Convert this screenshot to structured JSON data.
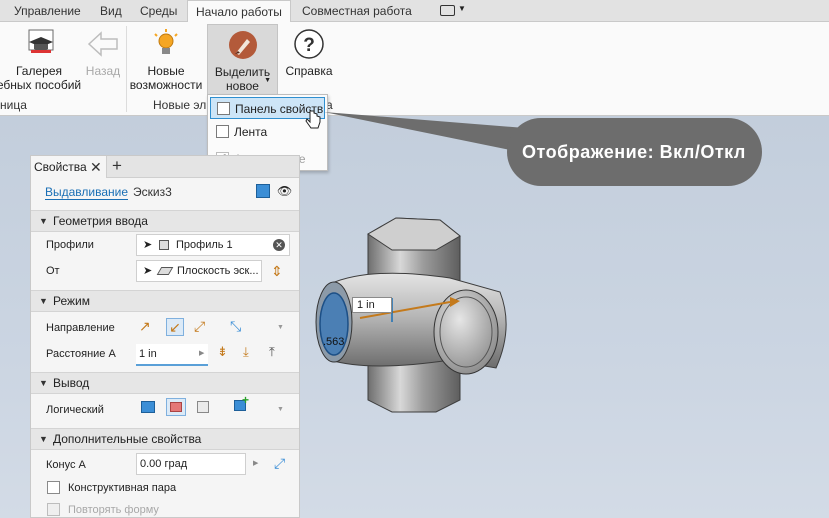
{
  "ribbon": {
    "tabs": [
      "Управление",
      "Вид",
      "Среды",
      "Начало работы",
      "Совместная работа"
    ],
    "buttons": {
      "gallery": "Галерея\nебных пособий",
      "back": "Назад",
      "whatsnew": "Новые\nвозможности",
      "highlight": "Выделить\nновое",
      "help": "Справка"
    },
    "groups": {
      "left": "ница",
      "middle": "Новые эл",
      "right": "а"
    }
  },
  "menu": {
    "items": [
      "Панель свойств",
      "Лента",
      "Автоскрытие"
    ]
  },
  "callout": "Отображение: Вкл/Откл",
  "panel": {
    "tab": "Свойства",
    "close": "✕",
    "add": "+",
    "breadcrumb": {
      "feature": "Выдавливание",
      "sketch": "Эскиз3"
    },
    "sections": {
      "geometry": "Геометрия ввода",
      "mode": "Режим",
      "output": "Вывод",
      "advanced": "Дополнительные свойства"
    },
    "rows": {
      "profiles": "Профили",
      "profiles_value": "Профиль 1",
      "from": "От",
      "from_value": "Плоскость эск...",
      "direction": "Направление",
      "distance": "Расстояние А",
      "distance_value": "1 in",
      "boolean": "Логический",
      "taper": "Конус А",
      "taper_value": "0.00 град",
      "constr_pair": "Конструктивная пара",
      "repeat_form": "Повторять форму"
    }
  },
  "viewport": {
    "dim_label": "1 in",
    "dim_label2": ".563"
  },
  "colors": {
    "accent": "#2f8fd0",
    "callout": "#6d6d6d",
    "link": "#1a6fb5"
  }
}
